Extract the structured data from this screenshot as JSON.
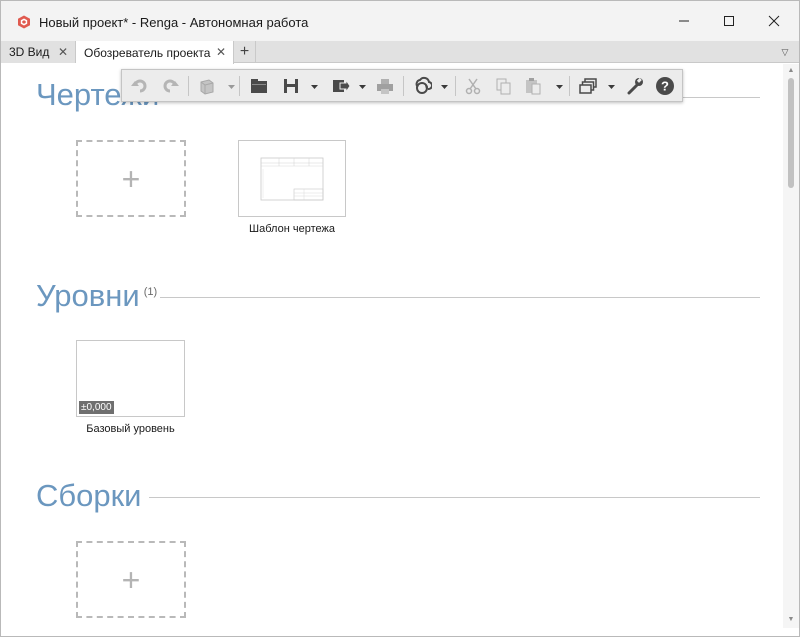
{
  "window": {
    "title": "Новый проект* - Renga - Автономная работа"
  },
  "tabs": [
    {
      "label": "3D Вид",
      "close": "✕"
    },
    {
      "label": "Обозреватель проекта",
      "close": "✕"
    }
  ],
  "tab_add": "+",
  "toolbar": {
    "items": [
      "undo-icon",
      "redo-icon",
      "3d-view-icon",
      "open-folder-icon",
      "save-icon",
      "export-icon",
      "print-icon",
      "sync-icon",
      "cut-icon",
      "copy-icon",
      "paste-icon",
      "windows-icon",
      "settings-wrench-icon",
      "help-icon"
    ],
    "help_label": "?"
  },
  "sections": {
    "drawings": {
      "title": "Чертежи",
      "add": "+",
      "items": [
        {
          "label": "Шаблон чертежа"
        }
      ]
    },
    "levels": {
      "title": "Уровни",
      "count": "(1)",
      "items": [
        {
          "label": "Базовый уровень",
          "badge": "±0,000"
        }
      ]
    },
    "assemblies": {
      "title": "Сборки",
      "add": "+"
    }
  },
  "colors": {
    "section_title": "#6b97bf",
    "app_icon": "#d9534f"
  }
}
